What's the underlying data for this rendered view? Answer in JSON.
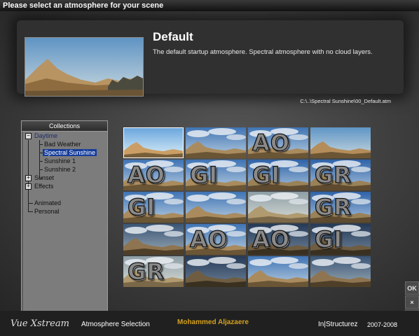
{
  "window": {
    "title": "Please select an atmosphere for your scene"
  },
  "current": {
    "name": "Default",
    "description": "The default startup atmosphere. Spectral atmosphere with no cloud layers.",
    "path": "C:\\..\\Spectral Sunshine\\00_Default.atm"
  },
  "collections": {
    "header": "Collections",
    "items": [
      {
        "label": "Daytime",
        "expander": "−"
      },
      {
        "label": "Bad Weather"
      },
      {
        "label": "Spectral Sunshine",
        "selected": true
      },
      {
        "label": "Sunshine 1"
      },
      {
        "label": "Sunshine 2"
      },
      {
        "label": "Sunset",
        "expander": "+"
      },
      {
        "label": "Effects",
        "expander": "+"
      },
      {
        "label": "Animated"
      },
      {
        "label": "Personal"
      }
    ]
  },
  "thumbnails": [
    {
      "text": "",
      "style": "clear-desert",
      "selected": true
    },
    {
      "text": "",
      "style": "cloudy-day"
    },
    {
      "text": "AO",
      "style": "cloudy-day"
    },
    {
      "text": "",
      "style": "clear-desert"
    },
    {
      "text": "AO",
      "style": "cloudy-day"
    },
    {
      "text": "GI",
      "style": "cloudy-day"
    },
    {
      "text": "GI",
      "style": "blue-sky"
    },
    {
      "text": "GR",
      "style": "blue-sky"
    },
    {
      "text": "GI",
      "style": "cloudy-day"
    },
    {
      "text": "",
      "style": "cloudy-day"
    },
    {
      "text": "",
      "style": "hazy"
    },
    {
      "text": "GR",
      "style": "blue-sky"
    },
    {
      "text": "",
      "style": "dusk-clouds"
    },
    {
      "text": "AO",
      "style": "cloudy-day"
    },
    {
      "text": "AO",
      "style": "dark-clouds"
    },
    {
      "text": "GI",
      "style": "dark-clouds"
    },
    {
      "text": "GR",
      "style": "hazy"
    },
    {
      "text": "",
      "style": "dark-clouds"
    },
    {
      "text": "",
      "style": "cloudy-day"
    },
    {
      "text": "",
      "style": "dusk-clouds"
    }
  ],
  "buttons": {
    "ok": "OK",
    "cancel": "×",
    "help": "?"
  },
  "footer": {
    "product": "Vue Xstream",
    "subtitle": "Atmosphere Selection",
    "author": "Mohammed Aljazaere",
    "brand": "In|Structurez",
    "years": "2007-2008"
  },
  "colors": {
    "selection": "#153c9a",
    "author": "#d4a11e"
  }
}
